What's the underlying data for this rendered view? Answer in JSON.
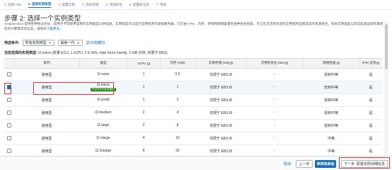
{
  "steps": [
    {
      "label": "1. 选择 AMI",
      "active": false
    },
    {
      "label": "2. 选择实例类型",
      "active": true
    },
    {
      "label": "3. 配置实例",
      "active": false
    },
    {
      "label": "4. 添加存储",
      "active": false
    },
    {
      "label": "5. 添加标签",
      "active": false
    },
    {
      "label": "6. 配置安全组",
      "active": false
    },
    {
      "label": "7. 审核",
      "active": false
    }
  ],
  "page_title": "步骤 2: 选择一个实例类型",
  "intro": {
    "text": "Amazon EC2 提供各种经过优化、适用于不同使用案例的实例类型以供选择。实例就是可以运行应用程序的虚拟服务器。它们由 CPU、内存、存储和网络容量的各种组合组成，可让您灵活地为您的应用程序选择适当的资源组合。有关实例类型以及这些类型如何满足您的计算需求的信息，请参阅",
    "link": "了解更多",
    "suffix": "。"
  },
  "filter": {
    "label": "筛选条件:",
    "family_select": "所有实例类型",
    "generation_select": "最新一代",
    "toggle_link": "显示/隐藏列"
  },
  "current": {
    "label": "当前选择的实例类型:",
    "value": "t2.micro (变量 ECU, 1 vCPU, 2.5 GHz, Intel Xeon Family, 1 GiB 内存, 仅限于 EBS)"
  },
  "table": {
    "headers": [
      "系列",
      "类型",
      "vCPU",
      "内存 (GiB)",
      "实例存储 (GB)",
      "可用的优化 EBS",
      "网络性能",
      "IPv6 支持"
    ],
    "rows": [
      {
        "family": "通用型",
        "type": "t2.nano",
        "vcpu": "1",
        "memory": "0.5",
        "storage": "仅限于 EBS",
        "ebs": "-",
        "network": "低到中等",
        "ipv6": "是",
        "selected": false,
        "badge": ""
      },
      {
        "family": "通用型",
        "type": "t2.micro",
        "vcpu": "1",
        "memory": "1",
        "storage": "仅限于 EBS",
        "ebs": "-",
        "network": "低到中等",
        "ipv6": "是",
        "selected": true,
        "badge": "符合条件的免费套餐"
      },
      {
        "family": "通用型",
        "type": "t2.small",
        "vcpu": "1",
        "memory": "2",
        "storage": "仅限于 EBS",
        "ebs": "-",
        "network": "低到中等",
        "ipv6": "是",
        "selected": false,
        "badge": ""
      },
      {
        "family": "通用型",
        "type": "t2.medium",
        "vcpu": "2",
        "memory": "4",
        "storage": "仅限于 EBS",
        "ebs": "-",
        "network": "低到中等",
        "ipv6": "是",
        "selected": false,
        "badge": ""
      },
      {
        "family": "通用型",
        "type": "t2.large",
        "vcpu": "2",
        "memory": "8",
        "storage": "仅限于 EBS",
        "ebs": "-",
        "network": "低到中等",
        "ipv6": "是",
        "selected": false,
        "badge": ""
      },
      {
        "family": "通用型",
        "type": "t2.xlarge",
        "vcpu": "4",
        "memory": "16",
        "storage": "仅限于 EBS",
        "ebs": "-",
        "network": "中等",
        "ipv6": "是",
        "selected": false,
        "badge": ""
      },
      {
        "family": "通用型",
        "type": "t2.2xlarge",
        "vcpu": "8",
        "memory": "32",
        "storage": "仅限于 EBS",
        "ebs": "-",
        "network": "中等",
        "ipv6": "是",
        "selected": false,
        "badge": ""
      }
    ]
  },
  "footer": {
    "cancel": "取消",
    "prev": "上一步",
    "launch": "审核和启动",
    "next": "下一步: 配置实例详细信息"
  },
  "colors": {
    "accent": "#146eb4",
    "free_badge": "#1d8102",
    "highlight": "#e03a3a"
  }
}
